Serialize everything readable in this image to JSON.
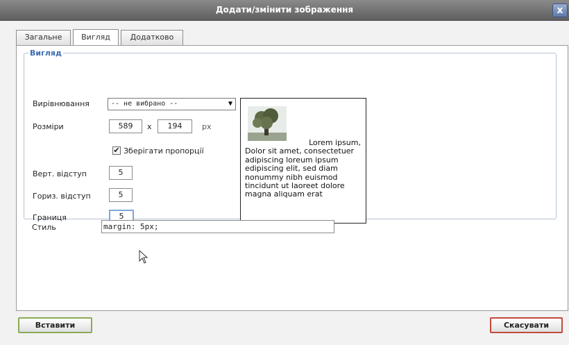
{
  "window": {
    "title": "Додати/змінити зображення",
    "close_label": "x"
  },
  "tabs": [
    {
      "label": "Загальне",
      "active": false
    },
    {
      "label": "Вигляд",
      "active": true
    },
    {
      "label": "Додатково",
      "active": false
    }
  ],
  "appearance": {
    "legend": "Вигляд",
    "align_label": "Вирівнювання",
    "align_value": "-- не вибрано --",
    "dimensions_label": "Розміри",
    "width": "589",
    "times": "x",
    "height": "194",
    "unit": "px",
    "keep_proportions_label": "Зберігати пропорції",
    "keep_proportions_checked": true,
    "vspace_label": "Верт. відступ",
    "vspace": "5",
    "hspace_label": "Гориз. відступ",
    "hspace": "5",
    "border_label": "Границя",
    "border": "5",
    "style_label": "Стиль",
    "style_value": "margin: 5px;"
  },
  "preview": {
    "first_line": "Lorem ipsum,",
    "body": "Dolor sit amet, consectetuer adipiscing loreum ipsum edipiscing elit, sed diam nonummy nibh euismod tincidunt ut laoreet dolore magna aliquam erat"
  },
  "buttons": {
    "insert": "Вставити",
    "cancel": "Скасувати"
  },
  "colors": {
    "legend_blue": "#3a6bb0",
    "insert_border": "#8aab57",
    "cancel_border": "#c24a3a"
  }
}
